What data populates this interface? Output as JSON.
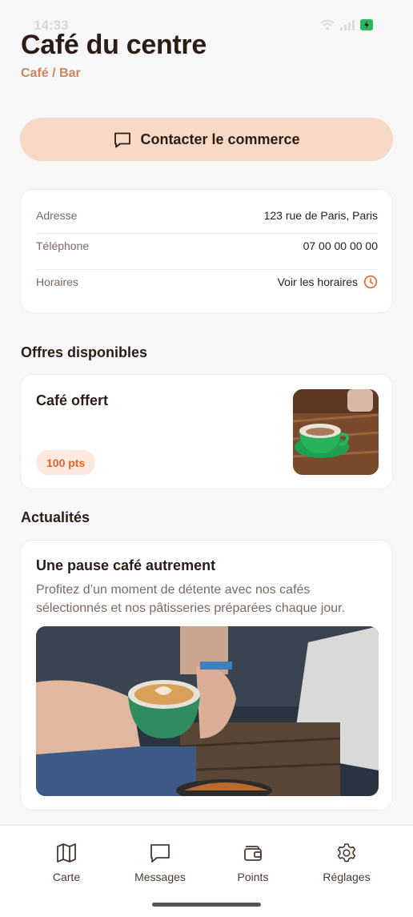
{
  "status_bar": {
    "time": "14:33"
  },
  "header": {
    "title": "Café du centre",
    "category": "Café / Bar"
  },
  "contact_button": {
    "label": "Contacter le commerce",
    "icon": "message-icon"
  },
  "info": {
    "rows": [
      {
        "label": "Adresse",
        "value": "123 rue de Paris, Paris"
      },
      {
        "label": "Téléphone",
        "value": "07 00 00 00 00"
      },
      {
        "label": "Horaires",
        "value": "Voir les horaires",
        "icon": "clock-icon"
      }
    ]
  },
  "offers": {
    "section_title": "Offres disponibles",
    "items": [
      {
        "title": "Café offert",
        "points": "100 pts"
      }
    ]
  },
  "news": {
    "section_title": "Actualités",
    "items": [
      {
        "title": "Une pause café autrement",
        "body": "Profitez d’un moment de détente avec nos cafés sélectionnés et nos pâtisseries préparées chaque jour."
      }
    ]
  },
  "tab_bar": {
    "tabs": [
      {
        "label": "Carte",
        "icon": "map-icon"
      },
      {
        "label": "Messages",
        "icon": "message-icon"
      },
      {
        "label": "Points",
        "icon": "wallet-icon"
      },
      {
        "label": "Réglages",
        "icon": "gear-icon"
      }
    ]
  },
  "colors": {
    "accent": "#e0652a",
    "button_bg": "#f8d9c6",
    "subtitle": "#c8875d",
    "text": "#2b1d15",
    "muted": "#7d6a5f"
  }
}
